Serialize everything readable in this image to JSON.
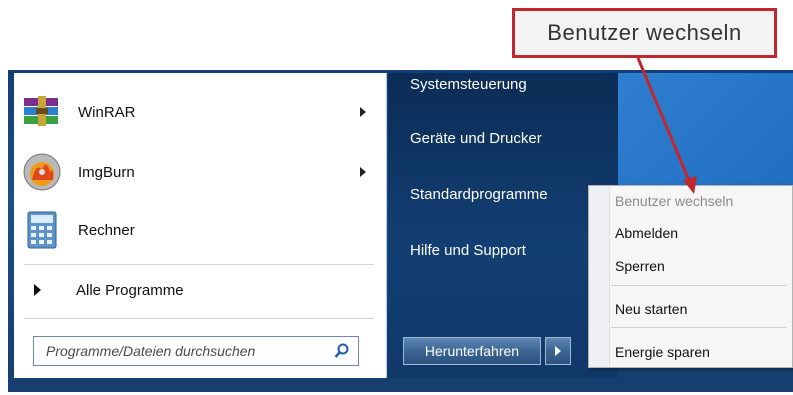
{
  "callout": {
    "text": "Benutzer wechseln"
  },
  "programs": [
    {
      "label": "WinRAR",
      "icon": "winrar-icon",
      "has_submenu": true
    },
    {
      "label": "ImgBurn",
      "icon": "imgburn-icon",
      "has_submenu": true
    },
    {
      "label": "Rechner",
      "icon": "calculator-icon",
      "has_submenu": false
    }
  ],
  "all_programs": {
    "label": "Alle Programme"
  },
  "search": {
    "placeholder": "Programme/Dateien durchsuchen"
  },
  "right_links": [
    {
      "label": "Systemsteuerung"
    },
    {
      "label": "Geräte und Drucker"
    },
    {
      "label": "Standardprogramme"
    },
    {
      "label": "Hilfe und Support"
    }
  ],
  "shutdown": {
    "label": "Herunterfahren"
  },
  "submenu": {
    "items": [
      {
        "label": "Benutzer wechseln",
        "enabled": false
      },
      {
        "label": "Abmelden",
        "enabled": true
      },
      {
        "label": "Sperren",
        "enabled": true
      },
      {
        "label": "Neu starten",
        "enabled": true
      },
      {
        "label": "Energie sparen",
        "enabled": true
      }
    ]
  },
  "colors": {
    "callout_border": "#c0282d",
    "right_pane": "#123f73",
    "desktop": "#2f7fd0"
  }
}
